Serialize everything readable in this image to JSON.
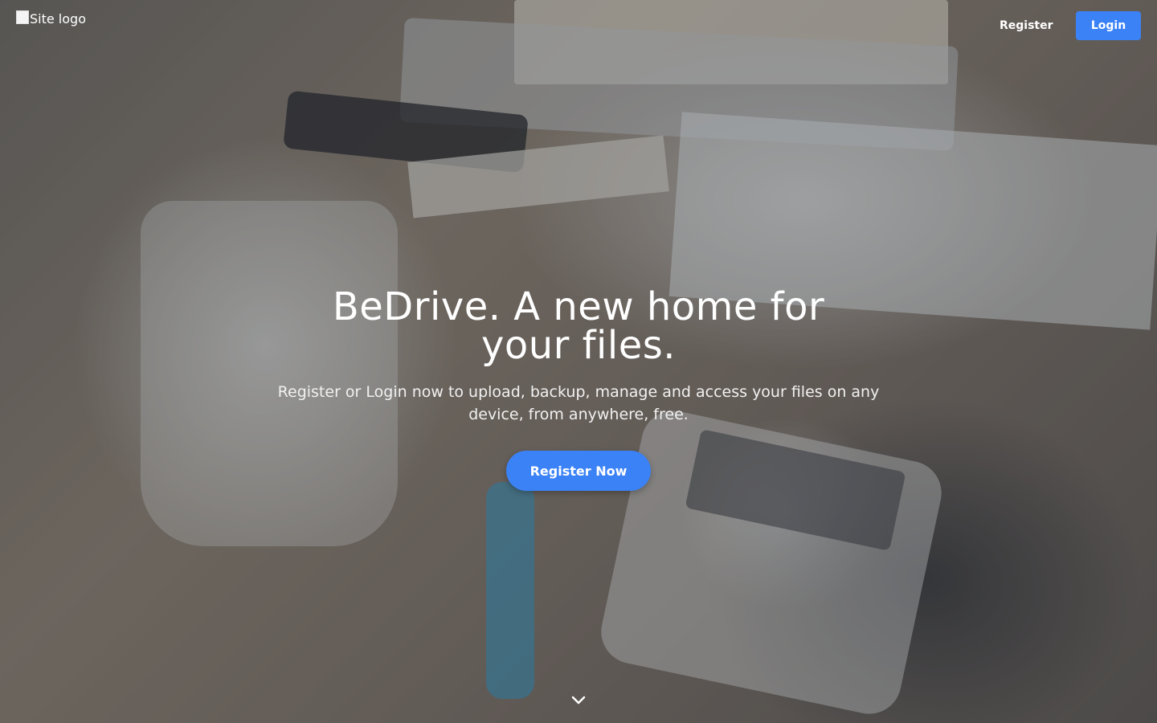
{
  "header": {
    "logo_alt": "Site logo",
    "register_label": "Register",
    "login_label": "Login"
  },
  "hero": {
    "title": "BeDrive. A new home for your files.",
    "subtitle": "Register or Login now to upload, backup, manage and access your files on any device, from anywhere, free.",
    "cta_label": "Register Now"
  },
  "icons": {
    "scroll": "chevron-down-icon"
  },
  "colors": {
    "accent": "#3b82f6",
    "text": "#ffffff"
  }
}
